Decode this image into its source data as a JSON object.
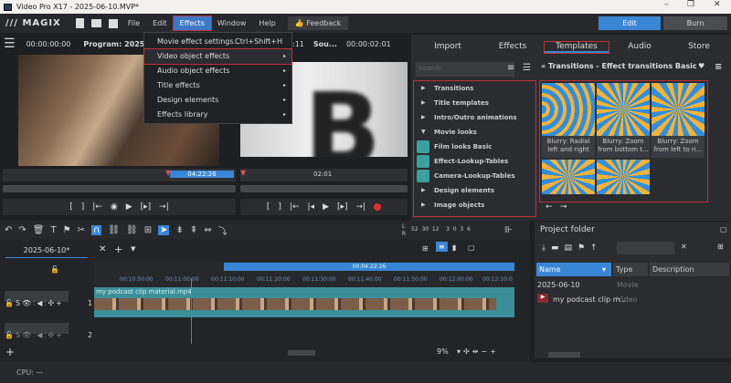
{
  "window": {
    "title": "Video Pro X17 - 2025-06-10.MVP*",
    "minimize": "–",
    "maximize": "❐",
    "close": "✕"
  },
  "menubar": {
    "logo": "/// MAGIX",
    "items": [
      "File",
      "Edit",
      "Effects",
      "Window",
      "Help"
    ],
    "feedback": "Feedback",
    "edit_button": "Edit",
    "burn_button": "Burn"
  },
  "effects_menu": [
    {
      "label": "Movie effect settings...",
      "shortcut": "Ctrl+Shift+H"
    },
    {
      "label": "Video object effects",
      "submenu": "▸"
    },
    {
      "label": "Audio object effects",
      "submenu": "▸"
    },
    {
      "label": "Title effects",
      "submenu": "▸"
    },
    {
      "label": "Design elements",
      "submenu": "▸"
    },
    {
      "label": "Effects library",
      "submenu": "▸"
    }
  ],
  "program_monitor": {
    "timecode": "00:00:00:00",
    "label": "Program: 2025-06-1",
    "position": "04:22:26"
  },
  "source_monitor": {
    "timecode_partial": ":11",
    "label": "Sou...",
    "timecode": "00:00:02:01",
    "position": "02:01",
    "letter": "B"
  },
  "right_panel": {
    "tabs": [
      "Import",
      "Effects",
      "Templates",
      "Audio",
      "Store"
    ],
    "active_tab": "Templates",
    "search_placeholder": "Search",
    "tree": [
      {
        "label": "Transitions",
        "type": "collapsed"
      },
      {
        "label": "Title templates",
        "type": "collapsed"
      },
      {
        "label": "Intro/Outro animations",
        "type": "collapsed"
      },
      {
        "label": "Movie looks",
        "type": "expanded"
      },
      {
        "label": "Film looks Basic",
        "type": "child"
      },
      {
        "label": "Effect-Lookup-Tables",
        "type": "child"
      },
      {
        "label": "Camera-Lookup-Tables",
        "type": "child"
      },
      {
        "label": "Design elements",
        "type": "collapsed"
      },
      {
        "label": "Image objects",
        "type": "collapsed"
      }
    ],
    "breadcrumb": "Transitions - Effect transitions Basic",
    "templates": [
      {
        "caption1": "Blurry: Radial",
        "caption2": "left and right"
      },
      {
        "caption1": "Blurry: Zoom",
        "caption2": "from bottom t..."
      },
      {
        "caption1": "Blurry: Zoom",
        "caption2": "from left to ri..."
      }
    ]
  },
  "timeline": {
    "tab": "2025-06-10*",
    "range_duration": "00:04:22:26",
    "ruler": [
      "00:10:50:00",
      "00:11:00:00",
      "00:11:10:00",
      "00:11:20:00",
      "00:11:30:00",
      "00:11:40:00",
      "00:11:50:00",
      "00:12:00:00",
      "00:12:10:0"
    ],
    "clip_name": "my podcast clip material.mp4",
    "track_numbers": [
      "1",
      "2"
    ],
    "zoom": "9%",
    "meter_scale": "52  30  12    3  0  3  6",
    "meter_l": "L",
    "meter_r": "R"
  },
  "project_folder": {
    "title": "Project folder",
    "columns": [
      "Name",
      "Type",
      "Description"
    ],
    "rows": [
      {
        "name": "2025-06-10",
        "type": "Movie"
      },
      {
        "name": "my podcast clip m...",
        "type": "Video"
      }
    ]
  },
  "status": {
    "cpu": "CPU: —"
  },
  "colors": {
    "accent": "#3a86d6",
    "highlight": "#c0303a",
    "clip": "#3b8f9a"
  }
}
